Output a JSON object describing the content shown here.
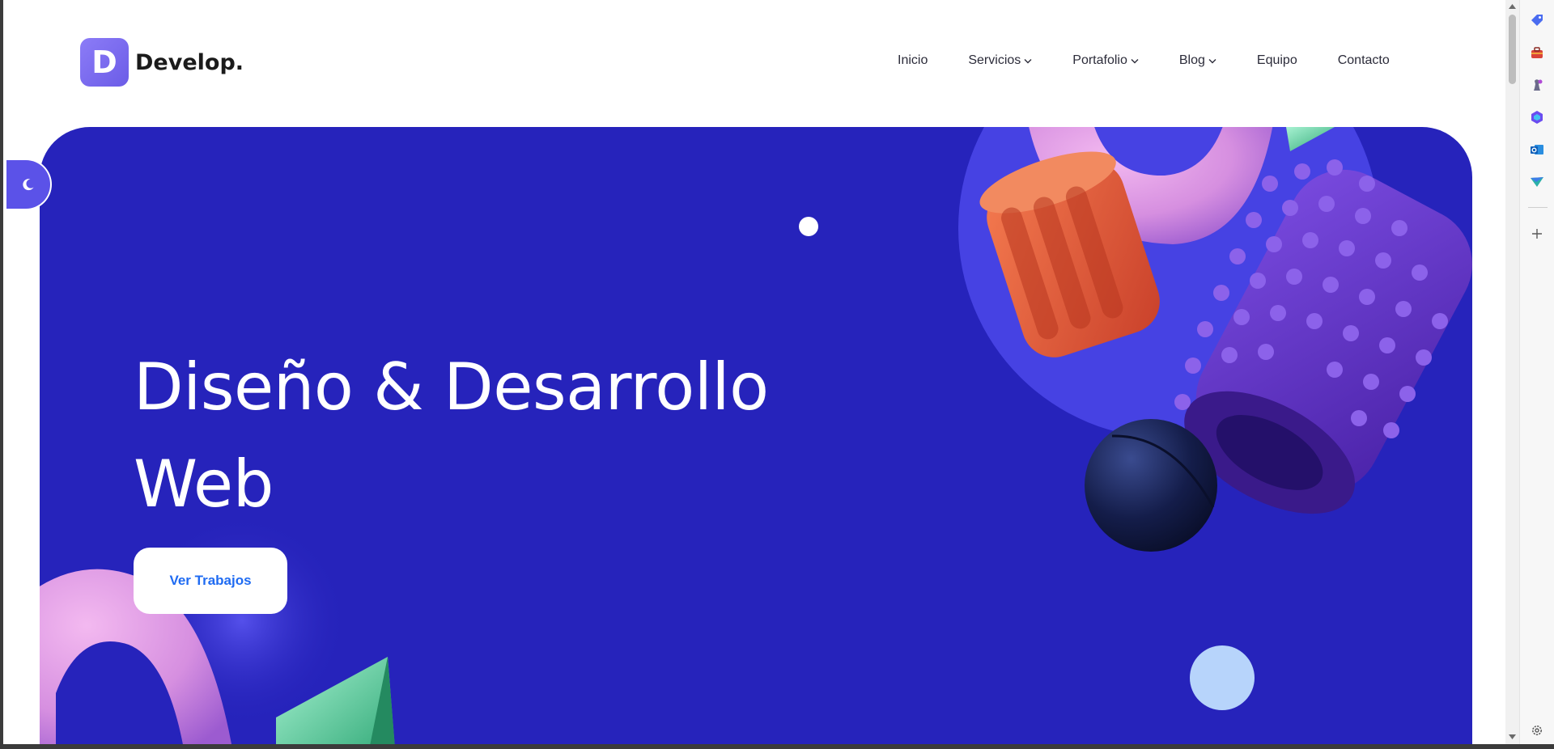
{
  "brand": {
    "logo_letter": "D",
    "name": "Develop."
  },
  "nav": {
    "items": [
      {
        "label": "Inicio",
        "has_dropdown": false
      },
      {
        "label": "Servicios",
        "has_dropdown": true
      },
      {
        "label": "Portafolio",
        "has_dropdown": true
      },
      {
        "label": "Blog",
        "has_dropdown": true
      },
      {
        "label": "Equipo",
        "has_dropdown": false
      },
      {
        "label": "Contacto",
        "has_dropdown": false
      }
    ]
  },
  "hero": {
    "title_line1": "Diseño & Desarrollo",
    "title_line2": "Web",
    "cta_label": "Ver Trabajos"
  },
  "theme_toggle": {
    "icon": "moon-icon"
  },
  "browser_sidebar": {
    "icons": [
      "tag-icon",
      "toolbox-icon",
      "chess-icon",
      "copilot-icon",
      "outlook-icon",
      "send-icon",
      "add-icon",
      "settings-icon"
    ]
  },
  "colors": {
    "hero_bg": "#2623bb",
    "cta_text": "#1f6bf2",
    "logo_gradient_start": "#8c7cf7",
    "logo_gradient_end": "#6b5ce7",
    "toggle_bg": "#5b52e8"
  }
}
